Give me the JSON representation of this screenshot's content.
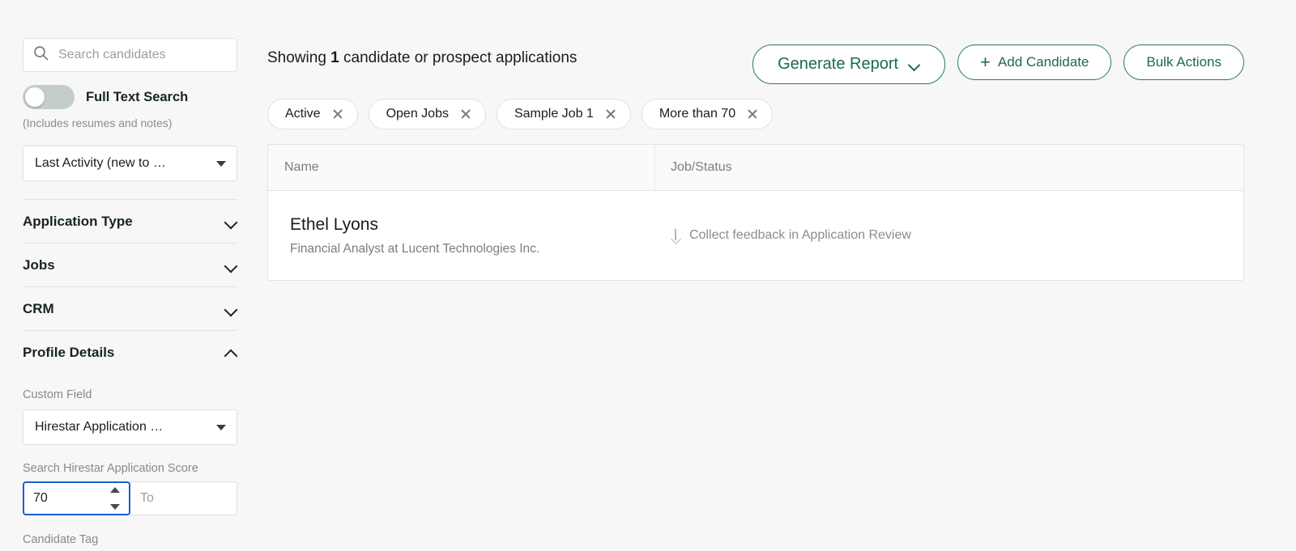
{
  "sidebar": {
    "search": {
      "placeholder": "Search candidates",
      "value": "",
      "icon": "search-icon"
    },
    "full_text_toggle": {
      "label": "Full Text Search",
      "sublabel": "(Includes resumes and notes)",
      "state": "off"
    },
    "sort_select": {
      "value": "Last Activity (new to …",
      "icon": "caret-down-icon"
    },
    "accordions": [
      {
        "label": "Application Type",
        "expanded": false,
        "icon": "chevron-down-icon"
      },
      {
        "label": "Jobs",
        "expanded": false,
        "icon": "chevron-down-icon"
      },
      {
        "label": "CRM",
        "expanded": false,
        "icon": "chevron-down-icon"
      },
      {
        "label": "Profile Details",
        "expanded": true,
        "icon": "chevron-up-icon"
      }
    ],
    "profile_details": {
      "custom_field_label": "Custom Field",
      "custom_field_value": "Hirestar Application …",
      "score_label": "Search Hirestar Application Score",
      "score_from_value": "70",
      "score_to_placeholder": "To",
      "score_to_value": ""
    },
    "candidate_tag_label": "Candidate Tag"
  },
  "main": {
    "showing_prefix": "Showing",
    "showing_count": "1",
    "showing_suffix": "candidate or prospect applications",
    "buttons": {
      "generate_report": "Generate Report",
      "add_candidate": "Add Candidate",
      "bulk_actions": "Bulk Actions",
      "plus_glyph": "+"
    },
    "filter_chips": [
      {
        "label": "Active"
      },
      {
        "label": "Open Jobs"
      },
      {
        "label": "Sample Job 1"
      },
      {
        "label": "More than 70"
      }
    ],
    "table": {
      "columns": [
        "Name",
        "Job/Status"
      ],
      "rows": [
        {
          "name": "Ethel Lyons",
          "subtitle": "Financial Analyst at Lucent Technologies Inc.",
          "status": "Collect feedback in Application Review"
        }
      ]
    }
  },
  "colors": {
    "brand_green": "#1e6b47",
    "page_bg": "#f7f7f7",
    "focus_blue": "#1a5fd0",
    "muted_text": "#8a8a8a"
  }
}
